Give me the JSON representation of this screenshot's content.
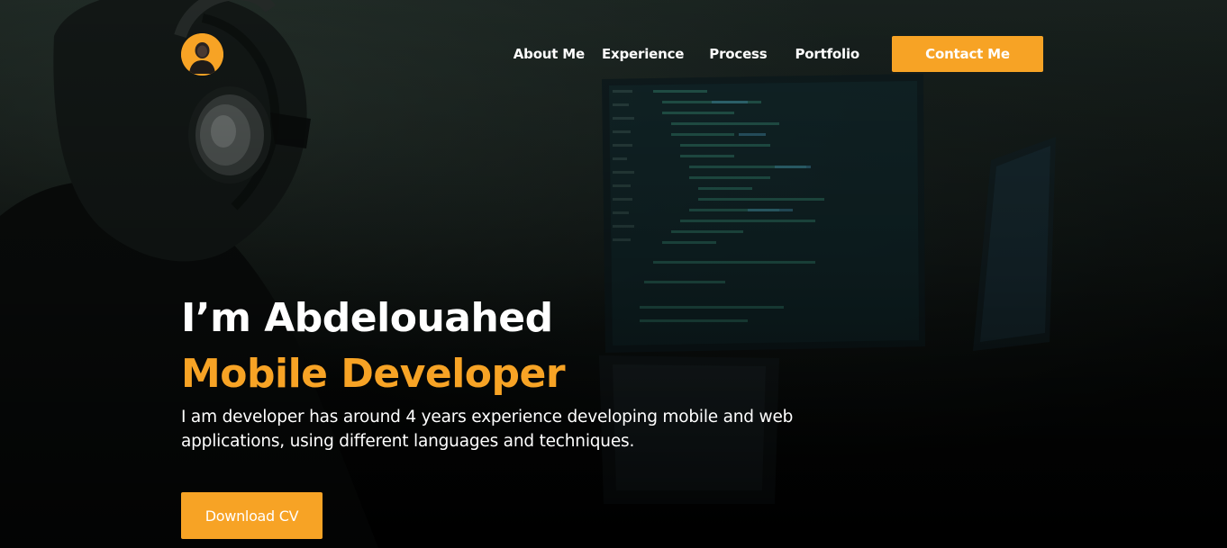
{
  "nav": {
    "avatar_icon": "profile-avatar",
    "links": [
      {
        "label": "About Me"
      },
      {
        "label": "Experience"
      },
      {
        "label": "Process"
      },
      {
        "label": "Portfolio"
      }
    ],
    "contact_label": "Contact Me"
  },
  "hero": {
    "title": "I’m Abdelouahed",
    "subtitle": "Mobile Developer",
    "description": "I am developer has around 4 years experience developing mobile and web applications, using different languages and techniques.",
    "download_label": "Download CV"
  },
  "colors": {
    "accent": "#f7a325",
    "text": "#ffffff",
    "background": "#000000"
  }
}
